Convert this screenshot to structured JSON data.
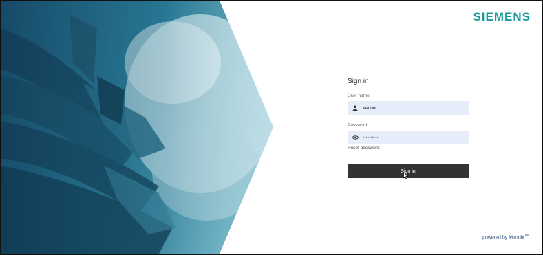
{
  "brand": {
    "name": "SIEMENS",
    "color": "#1a9a9a"
  },
  "login": {
    "title": "Sign in",
    "username": {
      "label": "User name",
      "value": "Vendor",
      "icon": "user-icon"
    },
    "password": {
      "label": "Password",
      "value": "••••••••••",
      "icon": "eye-icon"
    },
    "reset_link": "Reset password",
    "submit_label": "Sign in"
  },
  "footer": {
    "powered_by": "powered by Mendix",
    "trademark": "TM"
  },
  "colors": {
    "field_bg": "#e6ecfa",
    "button_bg": "#333333",
    "hero_teal": "#1f6f8f"
  }
}
